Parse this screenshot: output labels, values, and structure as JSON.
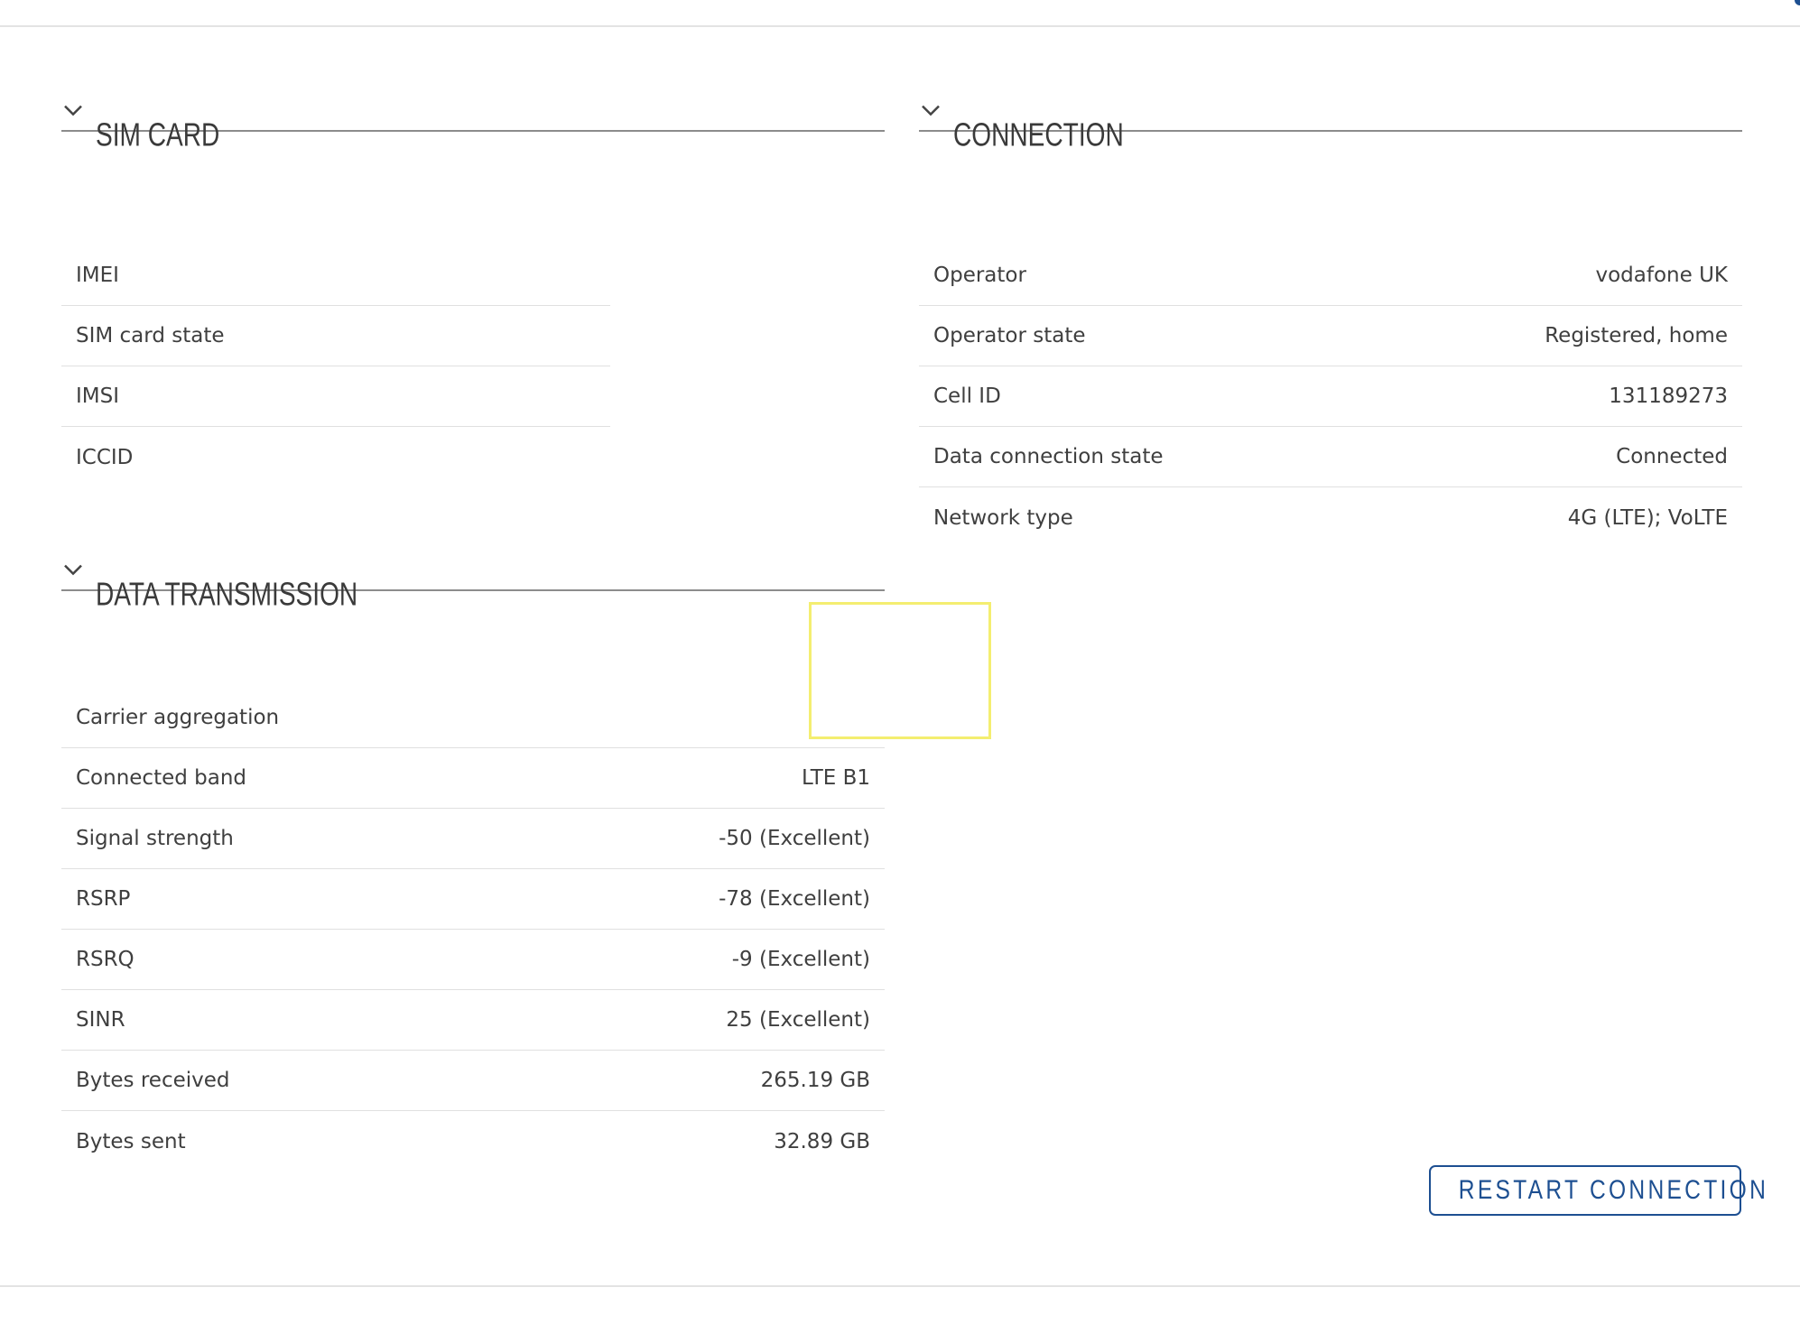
{
  "sim_card": {
    "title": "SIM CARD",
    "rows": [
      {
        "label": "IMEI",
        "value": ""
      },
      {
        "label": "SIM card state",
        "value": ""
      },
      {
        "label": "IMSI",
        "value": ""
      },
      {
        "label": "ICCID",
        "value": ""
      }
    ]
  },
  "connection": {
    "title": "CONNECTION",
    "rows": [
      {
        "label": "Operator",
        "value": "vodafone UK"
      },
      {
        "label": "Operator state",
        "value": "Registered, home"
      },
      {
        "label": "Cell ID",
        "value": "131189273"
      },
      {
        "label": "Data connection state",
        "value": "Connected"
      },
      {
        "label": "Network type",
        "value": "4G (LTE); VoLTE"
      }
    ]
  },
  "data_transmission": {
    "title": "DATA TRANSMISSION",
    "rows": [
      {
        "label": "Carrier aggregation",
        "value": ""
      },
      {
        "label": "Connected band",
        "value": "LTE B1"
      },
      {
        "label": "Signal strength",
        "value": "-50 (Excellent)"
      },
      {
        "label": "RSRP",
        "value": "-78 (Excellent)"
      },
      {
        "label": "RSRQ",
        "value": "-9 (Excellent)"
      },
      {
        "label": "SINR",
        "value": "25 (Excellent)"
      },
      {
        "label": "Bytes received",
        "value": "265.19 GB"
      },
      {
        "label": "Bytes sent",
        "value": "32.89 GB"
      }
    ]
  },
  "actions": {
    "restart_label": "RESTART CONNECTION"
  },
  "colors": {
    "accent": "#1d4f91",
    "highlight": "#f4ee70",
    "divider": "#e0e0e0"
  }
}
